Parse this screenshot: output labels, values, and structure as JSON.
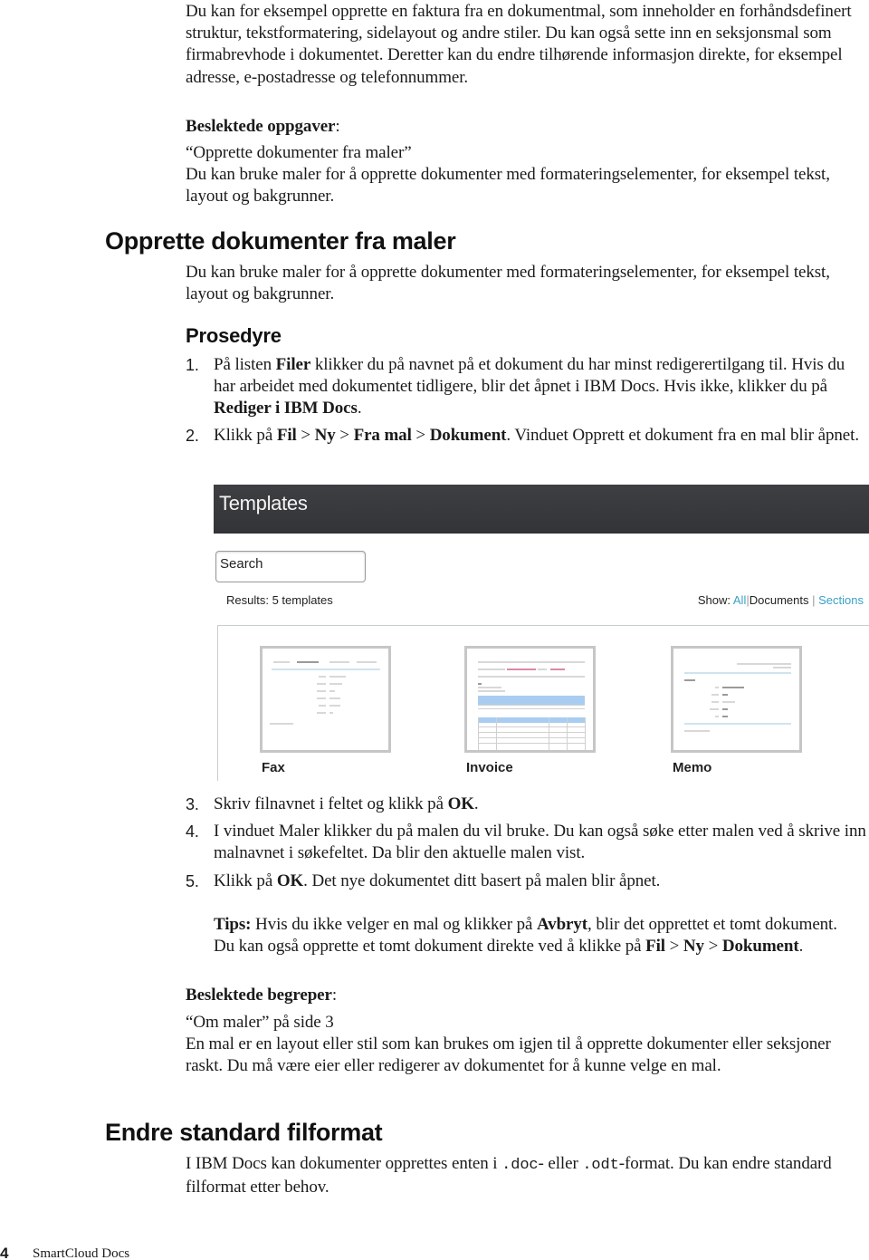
{
  "intro": {
    "paragraph": "Du kan for eksempel opprette en faktura fra en dokumentmal, som inneholder en forhåndsdefinert struktur, tekstformatering, sidelayout og andre stiler. Du kan også sette inn en seksjonsmal som firmabrevhode i dokumentet. Deretter kan du endre tilhørende informasjon direkte, for eksempel adresse, e-postadresse og telefonnummer.",
    "related_tasks_label": "Beslektede oppgaver",
    "related_tasks_colon": ":",
    "related_link": "“Opprette dokumenter fra maler”",
    "related_desc": "Du kan bruke maler for å opprette dokumenter med formateringselementer, for eksempel tekst, layout og bakgrunner."
  },
  "section_templates": {
    "title": "Opprette dokumenter fra maler",
    "intro": "Du kan bruke maler for å opprette dokumenter med formateringselementer, for eksempel tekst, layout og bakgrunner.",
    "procedure_title": "Prosedyre",
    "steps": [
      {
        "num": "1.",
        "parts": [
          {
            "t": "På listen ",
            "b": false
          },
          {
            "t": "Filer",
            "b": true
          },
          {
            "t": " klikker du på navnet på et dokument du har minst redigerertilgang til. Hvis du har arbeidet med dokumentet tidligere, blir det åpnet i IBM Docs. Hvis ikke, klikker du på ",
            "b": false
          },
          {
            "t": "Rediger i IBM Docs",
            "b": true
          },
          {
            "t": ".",
            "b": false
          }
        ]
      },
      {
        "num": "2.",
        "parts": [
          {
            "t": "Klikk på ",
            "b": false
          },
          {
            "t": "Fil",
            "b": true
          },
          {
            "t": " > ",
            "b": false
          },
          {
            "t": "Ny",
            "b": true
          },
          {
            "t": " > ",
            "b": false
          },
          {
            "t": "Fra mal",
            "b": true
          },
          {
            "t": " > ",
            "b": false
          },
          {
            "t": "Dokument",
            "b": true
          },
          {
            "t": ". Vinduet Opprett et dokument fra en mal blir åpnet.",
            "b": false
          }
        ]
      },
      {
        "num": "3.",
        "parts": [
          {
            "t": "Skriv filnavnet i feltet og klikk på ",
            "b": false
          },
          {
            "t": "OK",
            "b": true
          },
          {
            "t": ".",
            "b": false
          }
        ]
      },
      {
        "num": "4.",
        "parts": [
          {
            "t": "I vinduet Maler klikker du på malen du vil bruke. Du kan også søke etter malen ved å skrive inn malnavnet i søkefeltet. Da blir den aktuelle malen vist.",
            "b": false
          }
        ]
      },
      {
        "num": "5.",
        "parts": [
          {
            "t": "Klikk på ",
            "b": false
          },
          {
            "t": "OK",
            "b": true
          },
          {
            "t": ". Det nye dokumentet ditt basert på malen blir åpnet.",
            "b": false
          }
        ]
      }
    ],
    "tip": {
      "label": "Tips:",
      "parts": [
        {
          "t": " Hvis du ikke velger en mal og klikker på ",
          "b": false
        },
        {
          "t": "Avbryt",
          "b": true
        },
        {
          "t": ", blir det opprettet et tomt dokument. Du kan også opprette et tomt dokument direkte ved å klikke på ",
          "b": false
        },
        {
          "t": "Fil",
          "b": true
        },
        {
          "t": " > ",
          "b": false
        },
        {
          "t": "Ny",
          "b": true
        },
        {
          "t": " > ",
          "b": false
        },
        {
          "t": "Dokument",
          "b": true
        },
        {
          "t": ".",
          "b": false
        }
      ]
    },
    "related_concepts_label": "Beslektede begreper",
    "related_concepts_colon": ":",
    "related_concept_link": "“Om maler” på side 3",
    "related_concept_desc": "En mal er en layout eller stil som kan brukes om igjen til å opprette dokumenter eller seksjoner raskt. Du må være eier eller redigerer av dokumentet for å kunne velge en mal."
  },
  "templates_dialog": {
    "title": "Templates",
    "search_placeholder": "Search",
    "results_text": "Results: 5 templates",
    "show_label": "Show:",
    "filters": [
      "All",
      "Documents",
      "Sections"
    ],
    "filter_separator": "|",
    "link_color": "#3aa0c8",
    "header_color": "#3a3b3e",
    "templates": [
      {
        "name": "Fax"
      },
      {
        "name": "Invoice"
      },
      {
        "name": "Memo"
      }
    ]
  },
  "section_format": {
    "title": "Endre standard filformat",
    "text_before": "I IBM Docs kan dokumenter opprettes enten i ",
    "code1": ".doc",
    "text_mid": "- eller ",
    "code2": ".odt",
    "text_after": "-format. Du kan endre standard filformat etter behov."
  },
  "footer": {
    "page_number": "4",
    "product": "SmartCloud Docs"
  }
}
